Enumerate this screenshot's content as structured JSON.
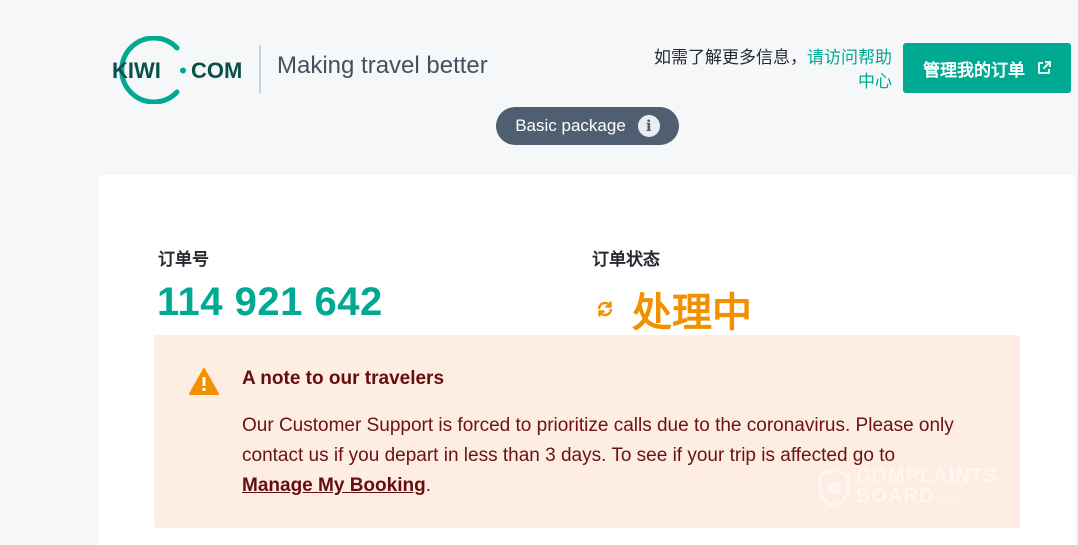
{
  "header": {
    "logo_text": "KIWI·COM",
    "tagline": "Making travel better",
    "help_prefix": "如需了解更多信息，",
    "help_link": "请访问帮助中心",
    "manage_button": "管理我的订单"
  },
  "package": {
    "label": "Basic package",
    "info_glyph": "i"
  },
  "booking": {
    "number_label": "订单号",
    "number": "114 921 642",
    "status_label": "订单状态",
    "status": "处理中"
  },
  "notice": {
    "title": "A note to our travelers",
    "body_before": "Our Customer Support is forced to prioritize calls due to the coronavirus. Please only contact us if you depart in less than 3 days. To see if your trip is affected go to ",
    "body_link": "Manage My Booking",
    "body_after": "."
  },
  "watermark": {
    "line1": "COMPLAINTS",
    "line2": "BOARD",
    "line2_suffix": ".com"
  },
  "colors": {
    "brand": "#00a991",
    "status": "#f29100",
    "notice_bg": "#fdede2",
    "notice_text": "#650e0e",
    "pill_bg": "#4f5e71"
  },
  "icons": {
    "external": "external-link-icon",
    "info": "info-icon",
    "status": "sync-icon",
    "warning": "warning-icon"
  }
}
